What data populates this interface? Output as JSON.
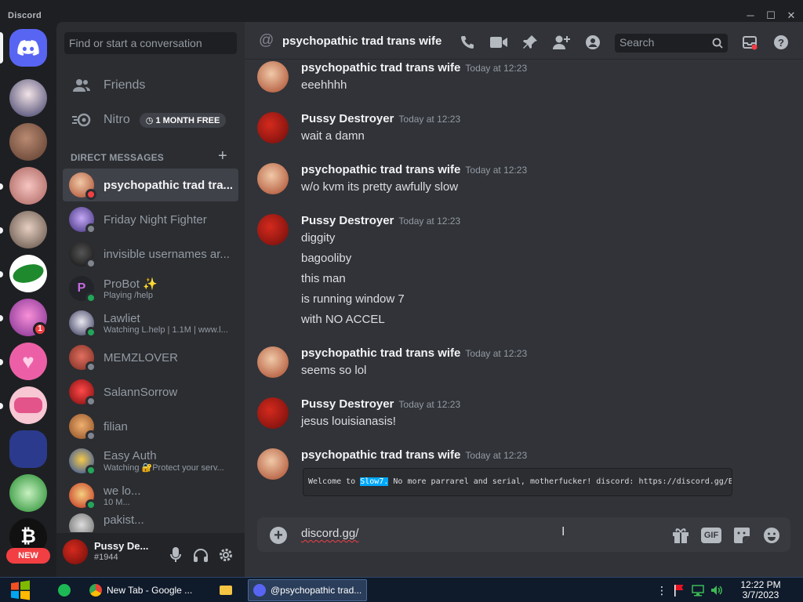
{
  "window": {
    "brand": "Discord"
  },
  "nav": {
    "search_placeholder": "Find or start a conversation",
    "friends": "Friends",
    "nitro": "Nitro",
    "nitro_badge": "1 MONTH FREE",
    "direct_messages_header": "DIRECT MESSAGES"
  },
  "servers": {
    "unread_badge": "1",
    "new_label": "NEW"
  },
  "dms": [
    {
      "name": "psychopathic trad tra...",
      "sub": "",
      "status": "dnd",
      "active": true
    },
    {
      "name": "Friday Night Fighter",
      "sub": "",
      "status": "offline",
      "active": false
    },
    {
      "name": "invisible usernames ar...",
      "sub": "",
      "status": "offline",
      "active": false
    },
    {
      "name": "ProBot ✨",
      "sub": "Playing /help",
      "status": "online",
      "active": false
    },
    {
      "name": "Lawliet",
      "sub": "Watching L.help | 1.1M | www.l...",
      "status": "online",
      "active": false
    },
    {
      "name": "MEMZLOVER",
      "sub": "",
      "status": "offline",
      "active": false
    },
    {
      "name": "SalannSorrow",
      "sub": "",
      "status": "offline",
      "active": false
    },
    {
      "name": "filian",
      "sub": "",
      "status": "offline",
      "active": false
    },
    {
      "name": "Easy Auth",
      "sub": "Watching 🔐Protect your serv...",
      "status": "online",
      "active": false
    },
    {
      "name": "we lo...",
      "sub": "10 M...",
      "status": "online",
      "active": false
    },
    {
      "name": "pakist...",
      "sub": "",
      "status": "offline",
      "active": false
    }
  ],
  "user": {
    "name": "Pussy De...",
    "tag": "#1944"
  },
  "chat": {
    "title": "psychopathic trad trans wife",
    "search_placeholder": "Search",
    "messages": [
      {
        "author": "psychopathic trad trans wife",
        "time": "Today at 12:23",
        "lines": [
          "eeehhhh"
        ]
      },
      {
        "author": "Pussy Destroyer",
        "time": "Today at 12:23",
        "lines": [
          "wait a damn"
        ]
      },
      {
        "author": "psychopathic trad trans wife",
        "time": "Today at 12:23",
        "lines": [
          "w/o kvm its pretty awfully slow"
        ]
      },
      {
        "author": "Pussy Destroyer",
        "time": "Today at 12:23",
        "lines": [
          "diggity",
          "bagooliby",
          "this man",
          "is running window 7",
          "with NO ACCEL"
        ]
      },
      {
        "author": "psychopathic trad trans wife",
        "time": "Today at 12:23",
        "lines": [
          "seems so lol"
        ]
      },
      {
        "author": "Pussy Destroyer",
        "time": "Today at 12:23",
        "lines": [
          "jesus louisianasis!"
        ]
      },
      {
        "author": "psychopathic trad trans wife",
        "time": "Today at 12:23",
        "lines": []
      }
    ],
    "embed": {
      "prefix": "Welcome to ",
      "highlight": "Slow7.",
      "suffix": " No more parrarel and serial, motherfucker! discord: https://discord.gg/BkmEjtXn"
    },
    "composer_text": "discord.gg/",
    "gif_label": "GIF"
  },
  "taskbar": {
    "tasks": [
      {
        "label": "New Tab - Google ...",
        "active": false
      },
      {
        "label": "@psychopathic trad...",
        "active": true
      }
    ],
    "time": "12:22 PM",
    "date": "3/7/2023"
  },
  "colors": {
    "blurple": "#5865f2",
    "online": "#23a55a",
    "dnd": "#f23f43",
    "offline": "#80848e"
  }
}
